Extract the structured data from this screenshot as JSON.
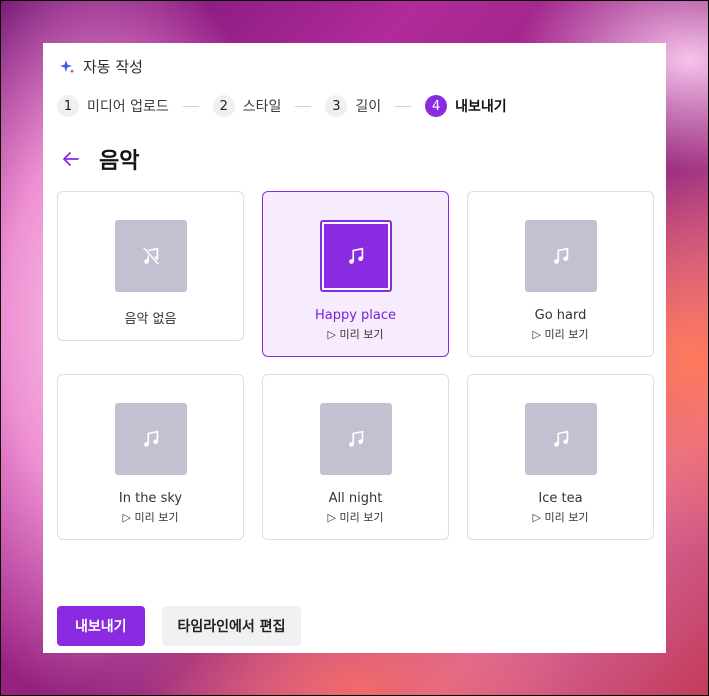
{
  "header": {
    "title": "자동 작성",
    "icon": "sparkle-icon"
  },
  "steps": [
    {
      "number": "1",
      "label": "미디어 업로드"
    },
    {
      "number": "2",
      "label": "스타일"
    },
    {
      "number": "3",
      "label": "길이"
    },
    {
      "number": "4",
      "label": "내보내기"
    }
  ],
  "page": {
    "title": "음악",
    "back_icon": "arrow-left-icon"
  },
  "music_options": [
    {
      "title": "음악 없음",
      "preview": "",
      "icon": "music-off-icon",
      "selected": false
    },
    {
      "title": "Happy place",
      "preview": "▷ 미리 보기",
      "icon": "music-note-icon",
      "selected": true
    },
    {
      "title": "Go hard",
      "preview": "▷ 미리 보기",
      "icon": "music-note-icon",
      "selected": false
    },
    {
      "title": "In the sky",
      "preview": "▷ 미리 보기",
      "icon": "music-note-icon",
      "selected": false
    },
    {
      "title": "All night",
      "preview": "▷ 미리 보기",
      "icon": "music-note-icon",
      "selected": false
    },
    {
      "title": "Ice tea",
      "preview": "▷ 미리 보기",
      "icon": "music-note-icon",
      "selected": false
    }
  ],
  "footer": {
    "export_label": "내보내기",
    "timeline_label": "타임라인에서 편집"
  },
  "colors": {
    "accent": "#8a2be2",
    "thumb_inactive": "#c3c0d1"
  }
}
